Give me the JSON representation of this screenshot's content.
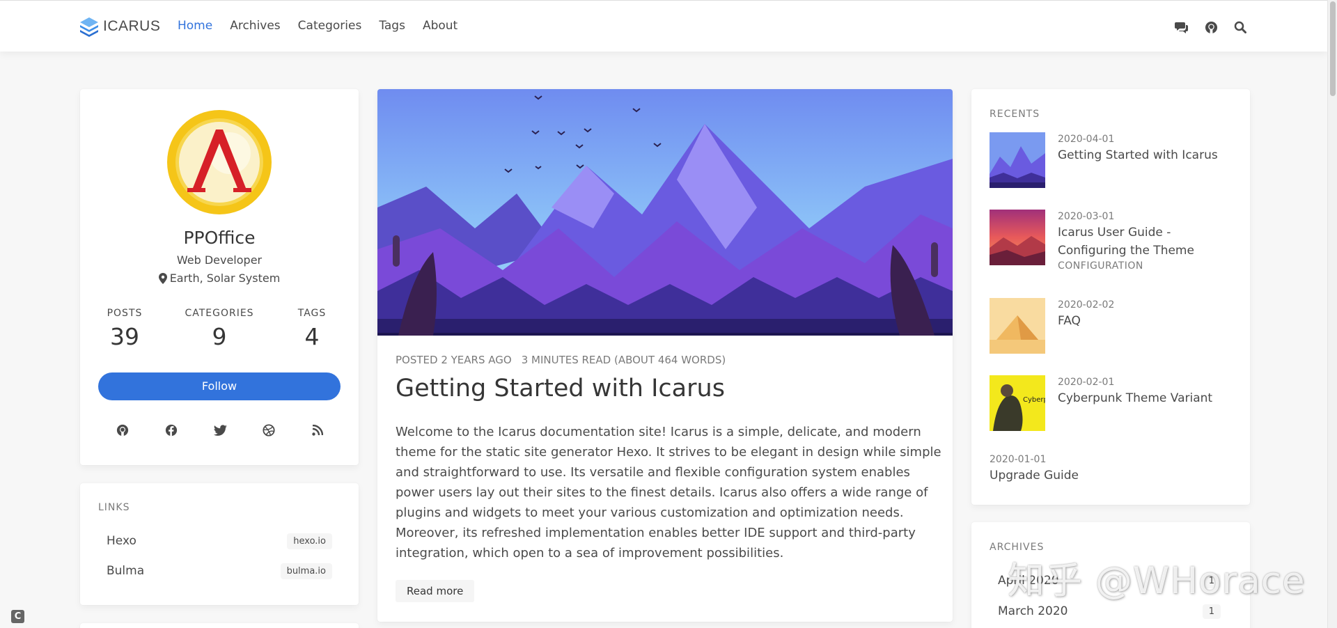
{
  "brand": {
    "name": "ICARUS"
  },
  "nav": [
    {
      "label": "Home",
      "active": true
    },
    {
      "label": "Archives",
      "active": false
    },
    {
      "label": "Categories",
      "active": false
    },
    {
      "label": "Tags",
      "active": false
    },
    {
      "label": "About",
      "active": false
    }
  ],
  "nav_icons": [
    "comments-icon",
    "github-icon",
    "search-icon"
  ],
  "profile": {
    "name": "PPOffice",
    "role": "Web Developer",
    "location": "Earth, Solar System",
    "stats": [
      {
        "label": "POSTS",
        "value": "39"
      },
      {
        "label": "CATEGORIES",
        "value": "9"
      },
      {
        "label": "TAGS",
        "value": "4"
      }
    ],
    "follow_label": "Follow",
    "socials": [
      "github-icon",
      "facebook-icon",
      "twitter-icon",
      "dribbble-icon",
      "rss-icon"
    ]
  },
  "links_widget": {
    "title": "LINKS",
    "items": [
      {
        "name": "Hexo",
        "tag": "hexo.io"
      },
      {
        "name": "Bulma",
        "tag": "bulma.io"
      }
    ]
  },
  "post": {
    "posted": "POSTED 2 YEARS AGO",
    "read": "3 MINUTES READ (ABOUT 464 WORDS)",
    "title": "Getting Started with Icarus",
    "body": "Welcome to the Icarus documentation site! Icarus is a simple, delicate, and modern theme for the static site generator Hexo. It strives to be elegant in design while simple and straightforward to use. Its versatile and flexible configuration system enables power users lay out their sites to the finest details. Icarus also offers a wide range of plugins and widgets to meet your various customization and optimization needs. Moreover, its refreshed implementation enables better IDE support and third-party integration, which open to a sea of improvement possibilities.",
    "readmore": "Read more"
  },
  "recents": {
    "title": "RECENTS",
    "items": [
      {
        "date": "2020-04-01",
        "title": "Getting Started with Icarus",
        "category": ""
      },
      {
        "date": "2020-03-01",
        "title": "Icarus User Guide - Configuring the Theme",
        "category": "CONFIGURATION"
      },
      {
        "date": "2020-02-02",
        "title": "FAQ",
        "category": ""
      },
      {
        "date": "2020-02-01",
        "title": "Cyberpunk Theme Variant",
        "category": ""
      },
      {
        "date": "2020-01-01",
        "title": "Upgrade Guide",
        "category": ""
      }
    ]
  },
  "archives": {
    "title": "ARCHIVES",
    "items": [
      {
        "name": "April 2020",
        "count": "1"
      },
      {
        "name": "March 2020",
        "count": "1"
      }
    ]
  },
  "watermark": "知乎 @WHorace",
  "colors": {
    "accent": "#3273dc",
    "text": "#4a4a4a",
    "muted": "#7a7a7a",
    "background": "#f7f7f7"
  }
}
